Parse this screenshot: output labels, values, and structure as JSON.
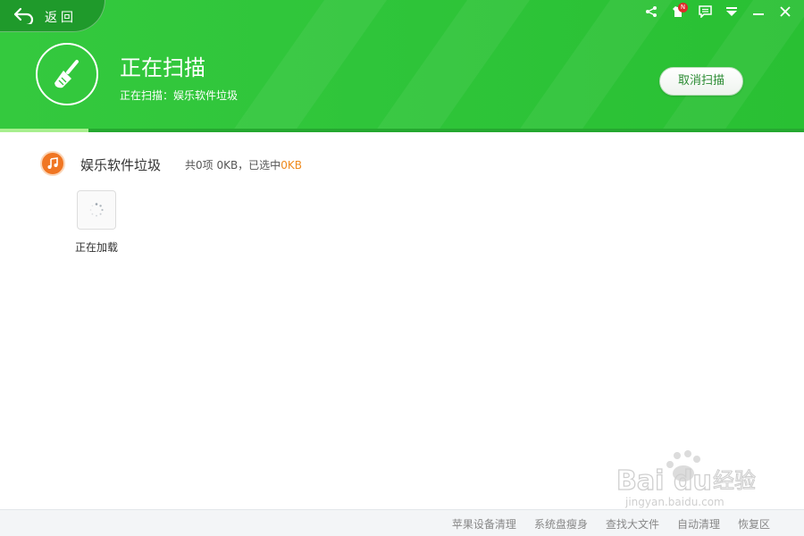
{
  "back": {
    "label": "返回",
    "icon": "back-arrow-icon"
  },
  "topbar": {
    "icons": [
      "share-icon",
      "skin-icon",
      "feedback-icon",
      "menu-icon",
      "minimize-icon",
      "close-icon"
    ],
    "badge": "N"
  },
  "header": {
    "title": "正在扫描",
    "subtitle": "正在扫描：娱乐软件垃圾",
    "icon": "broom-icon",
    "cancel_label": "取消扫描",
    "progress": 0.11
  },
  "category": {
    "icon": "music-note-icon",
    "name": "娱乐软件垃圾",
    "summary_prefix": "共0项 0KB，已选中",
    "selected": "0KB",
    "loading_label": "正在加载"
  },
  "footer": {
    "links": [
      "苹果设备清理",
      "系统盘瘦身",
      "查找大文件",
      "自动清理",
      "恢复区"
    ]
  },
  "watermark": {
    "brand": "Bai",
    "brand2": "du",
    "cn": "经验",
    "url": "jingyan.baidu.com"
  },
  "colors": {
    "accent_green": "#2fc53a",
    "orange": "#ef8a1d"
  }
}
